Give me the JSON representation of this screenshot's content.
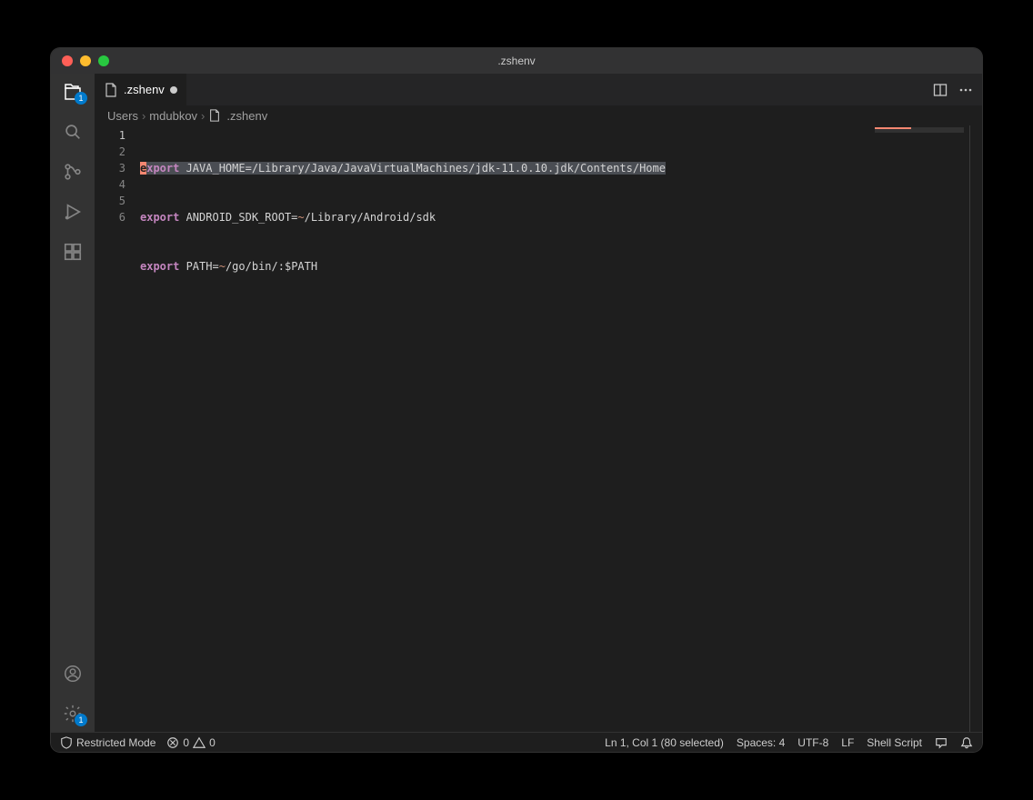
{
  "window": {
    "title": ".zshenv"
  },
  "activitybar": {
    "explorer_badge": "1",
    "settings_badge": "1"
  },
  "tab": {
    "label": ".zshenv"
  },
  "breadcrumbs": {
    "seg0": "Users",
    "seg1": "mdubkov",
    "seg2": ".zshenv"
  },
  "editor": {
    "lines": {
      "n1": "1",
      "n2": "2",
      "n3": "3",
      "n4": "4",
      "n5": "5",
      "n6": "6"
    },
    "l1": {
      "kw_first": "e",
      "kw_rest": "xport",
      "rest": " JAVA_HOME=/Library/Java/JavaVirtualMachines/jdk-11.0.10.jdk/Contents/Home"
    },
    "l2": {
      "kw": "export",
      "pre": " ANDROID_SDK_ROOT=",
      "tilde": "~",
      "post": "/Library/Android/sdk"
    },
    "l3": {
      "kw": "export",
      "pre": " PATH=",
      "tilde": "~",
      "post": "/go/bin/:$PATH"
    }
  },
  "status": {
    "restricted": "Restricted Mode",
    "errors": "0",
    "warnings": "0",
    "cursor": "Ln 1, Col 1 (80 selected)",
    "indent": "Spaces: 4",
    "encoding": "UTF-8",
    "eol": "LF",
    "language": "Shell Script"
  }
}
